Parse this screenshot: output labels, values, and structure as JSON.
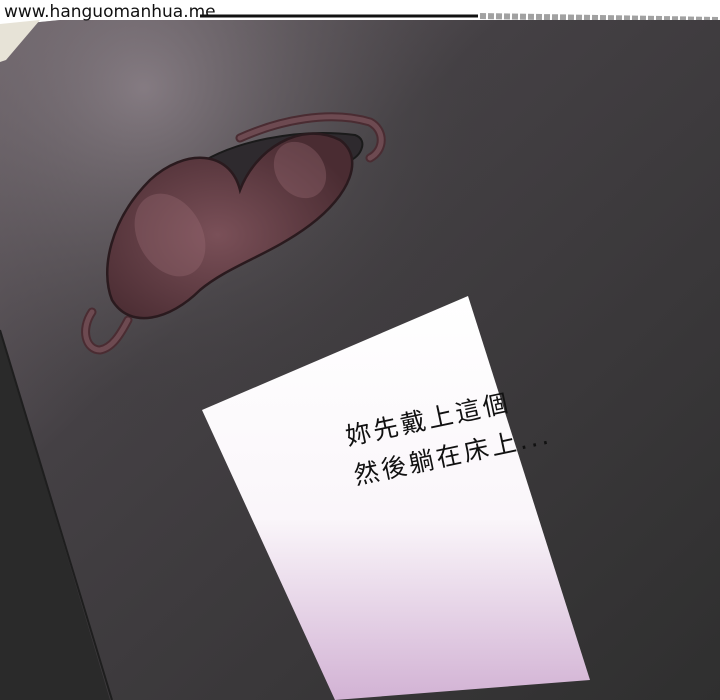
{
  "watermark": "www.hanguomanhua.me",
  "note": {
    "line1": "妳先戴上這個",
    "line2": "然後躺在床上..."
  },
  "colors": {
    "floor": "#3a3a3a",
    "floor_highlight": "#6a5f66",
    "mask": "#5d3a40",
    "paper_top": "#ffffff",
    "paper_bottom": "#d8b9d8"
  },
  "icons": {
    "sleep_mask": "sleep-mask-illustration"
  }
}
